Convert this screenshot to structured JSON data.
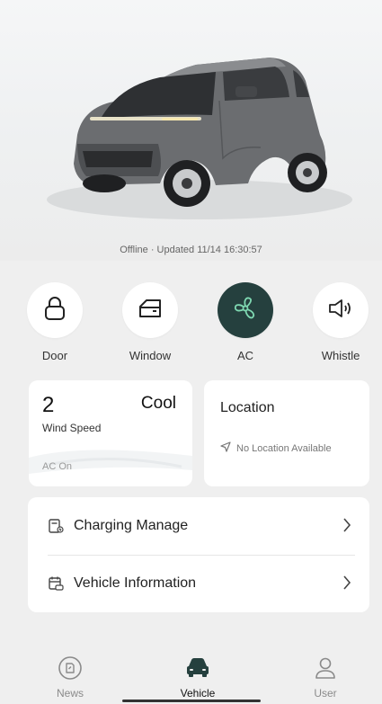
{
  "hero": {
    "status_text": "Offline · Updated 11/14 16:30:57"
  },
  "controls": [
    {
      "label": "Door",
      "icon": "lock-icon",
      "active": false
    },
    {
      "label": "Window",
      "icon": "window-icon",
      "active": false
    },
    {
      "label": "AC",
      "icon": "fan-icon",
      "active": true
    },
    {
      "label": "Whistle",
      "icon": "speaker-icon",
      "active": false
    }
  ],
  "ac": {
    "speed_value": "2",
    "speed_label": "Wind Speed",
    "mode": "Cool",
    "status": "AC On"
  },
  "location": {
    "title": "Location",
    "status": "No Location Available"
  },
  "menu": [
    {
      "label": "Charging Manage",
      "icon": "charging-icon"
    },
    {
      "label": "Vehicle Information",
      "icon": "vehicle-info-icon"
    }
  ],
  "tabs": [
    {
      "label": "News",
      "icon": "news-icon",
      "active": false
    },
    {
      "label": "Vehicle",
      "icon": "car-icon",
      "active": true
    },
    {
      "label": "User",
      "icon": "user-icon",
      "active": false
    }
  ],
  "colors": {
    "accent": "#25403e",
    "background": "#efefef",
    "card": "#ffffff"
  }
}
